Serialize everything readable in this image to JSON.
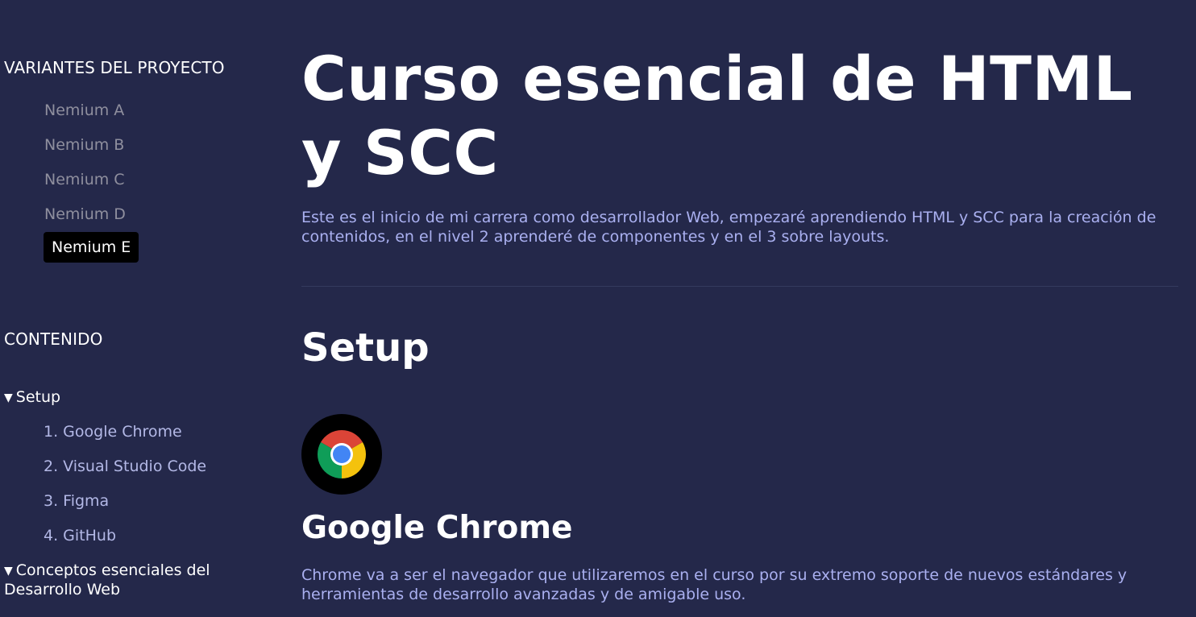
{
  "sidebar": {
    "variants_heading": "VARIANTES DEL PROYECTO",
    "variants": [
      {
        "label": "Nemium A",
        "active": false
      },
      {
        "label": "Nemium B",
        "active": false
      },
      {
        "label": "Nemium C",
        "active": false
      },
      {
        "label": "Nemium D",
        "active": false
      },
      {
        "label": "Nemium E",
        "active": true
      }
    ],
    "content_heading": "CONTENIDO",
    "toc": [
      {
        "label": "Setup",
        "caret": "▼",
        "items": [
          "1. Google Chrome",
          "2. Visual Studio Code",
          "3. Figma",
          "4. GitHub"
        ]
      },
      {
        "label": "Conceptos esenciales del Desarrollo Web",
        "caret": "▼",
        "items": []
      }
    ]
  },
  "main": {
    "title": "Curso esencial de HTML y SCC",
    "intro": "Este es el inicio de mi carrera como desarrollador Web, empezaré aprendiendo HTML y SCC para la creación de contenidos, en el nivel 2 aprenderé de componentes y en el 3 sobre layouts.",
    "section_title": "Setup",
    "tool": {
      "icon": "chrome-logo-icon",
      "title": "Google Chrome",
      "description": "Chrome va a ser el navegador que utilizaremos en el curso por su extremo soporte de nuevos estándares y herramientas de desarrollo avanzadas y de amigable uso."
    }
  },
  "colors": {
    "background": "#24284a",
    "link": "#b3b8e6",
    "muted": "#8f8f9e",
    "body_text": "#aab0f0",
    "active_bg": "#000000"
  }
}
